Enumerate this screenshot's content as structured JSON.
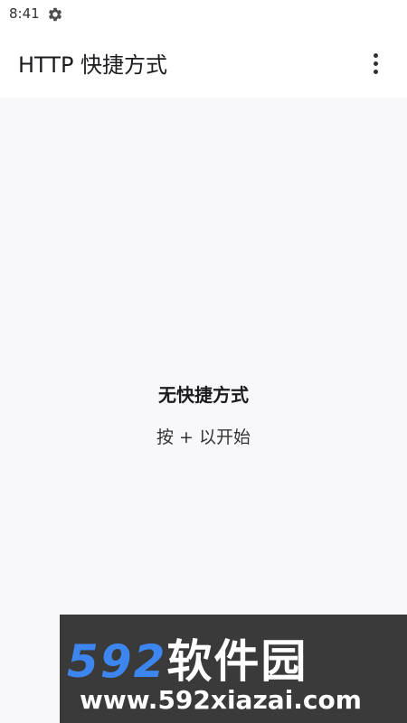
{
  "status_bar": {
    "time": "8:41",
    "settings_icon": "gear-icon"
  },
  "app_bar": {
    "title": "HTTP 快捷方式",
    "overflow_icon": "more-vert-icon"
  },
  "empty_state": {
    "title": "无快捷方式",
    "hint": "按 + 以开始"
  },
  "watermark": {
    "brand_number": "592",
    "brand_name": "软件园",
    "url": "www.592xiazai.com"
  },
  "colors": {
    "background": "#f8f8fb",
    "app_bar": "#ffffff",
    "watermark_bg": "#3a3a3a",
    "watermark_accent": "#3d86f0"
  }
}
